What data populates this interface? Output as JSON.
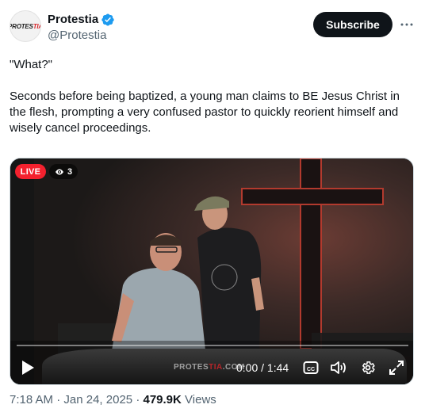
{
  "author": {
    "display_name": "Protestia",
    "handle": "@Protestia",
    "avatar_text_main": "PROTES",
    "avatar_text_accent": "TIA",
    "verified_icon": "verified-badge-icon",
    "verified_color": "#1d9bf0"
  },
  "actions": {
    "subscribe_label": "Subscribe",
    "more_icon": "more-horizontal-icon"
  },
  "tweet": {
    "quote": "\"What?\"",
    "body": "Seconds before being baptized, a young man claims to BE Jesus Christ in the flesh, prompting a very confused pastor to quickly reorient himself and wisely cancel proceedings."
  },
  "video": {
    "live_label": "LIVE",
    "viewers": "3",
    "watermark_main": "PROTES",
    "watermark_accent": "TIA",
    "watermark_suffix": ".COM",
    "time": "0:00 / 1:44",
    "progress": 0,
    "icons": [
      "play-icon",
      "captions-icon",
      "volume-icon",
      "settings-icon",
      "fullscreen-icon"
    ],
    "accent_color": "#f4212e"
  },
  "meta": {
    "time": "7:18 AM",
    "date": "Jan 24, 2025",
    "views_count": "479.9K",
    "views_label": "Views",
    "separator": "·"
  }
}
